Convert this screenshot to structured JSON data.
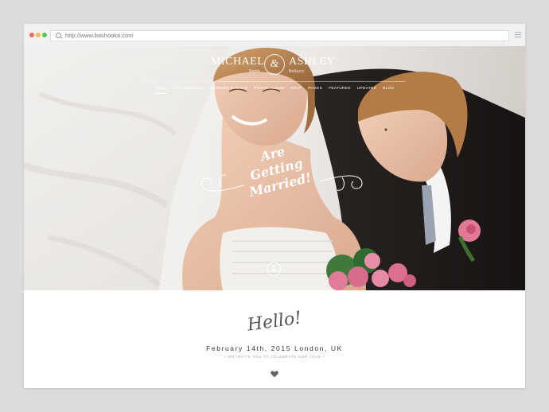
{
  "browser": {
    "url": "http://www.bashooka.com",
    "icons": [
      "search-icon",
      "menu-icon"
    ]
  },
  "hero": {
    "logo": {
      "groom_name": "MICHAEL",
      "groom_surname": "Smith",
      "ampersand": "&",
      "bride_name": "ASHLEY",
      "bride_surname": "Bellucci"
    },
    "nav": [
      "HOME",
      "THE WEDDING",
      "WEDDING EVENTS",
      "PHOTO ALBUM",
      "RSVP",
      "PAGES",
      "FEATURES",
      "UPDATES",
      "BLOG"
    ],
    "nav_active": "HOME",
    "tagline": [
      "Are",
      "Getting",
      "Married!"
    ]
  },
  "content": {
    "greeting": "Hello!",
    "date_location": "February 14th, 2015 London, UK",
    "invite_text": "~ WE INVITE YOU TO CELEBRATE OUR LOVE ~"
  },
  "colors": {
    "page_bg": "#dcdcdc",
    "heading_text": "#555555",
    "date_text": "#333333",
    "muted_text": "#aaaaaa"
  }
}
